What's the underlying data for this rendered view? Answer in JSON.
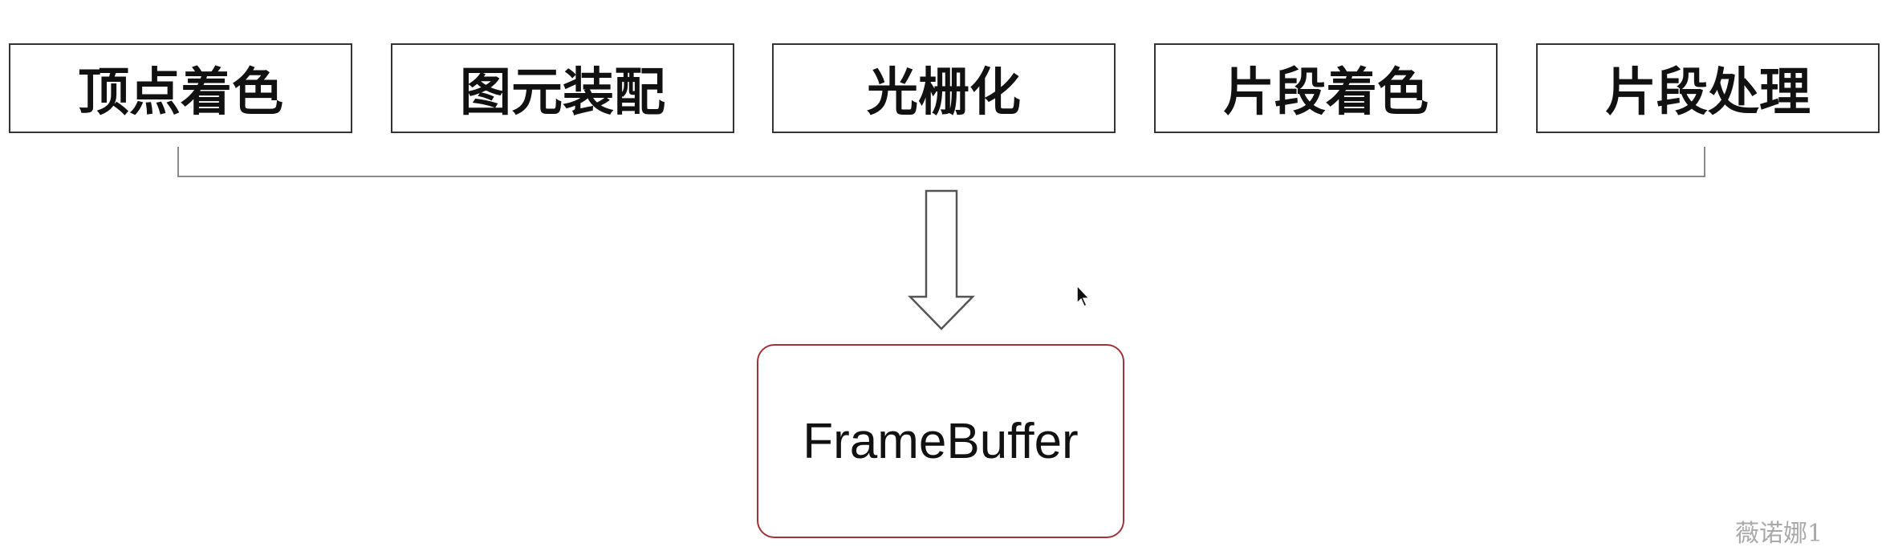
{
  "stages": [
    {
      "label": "顶点着色"
    },
    {
      "label": "图元装配"
    },
    {
      "label": "光栅化"
    },
    {
      "label": "片段着色"
    },
    {
      "label": "片段处理"
    }
  ],
  "output": {
    "label": "FrameBuffer",
    "border_color": "#a0333a"
  },
  "watermark": {
    "text": "薇诺娜1"
  },
  "cursor_icon": "pointer-arrow-icon"
}
